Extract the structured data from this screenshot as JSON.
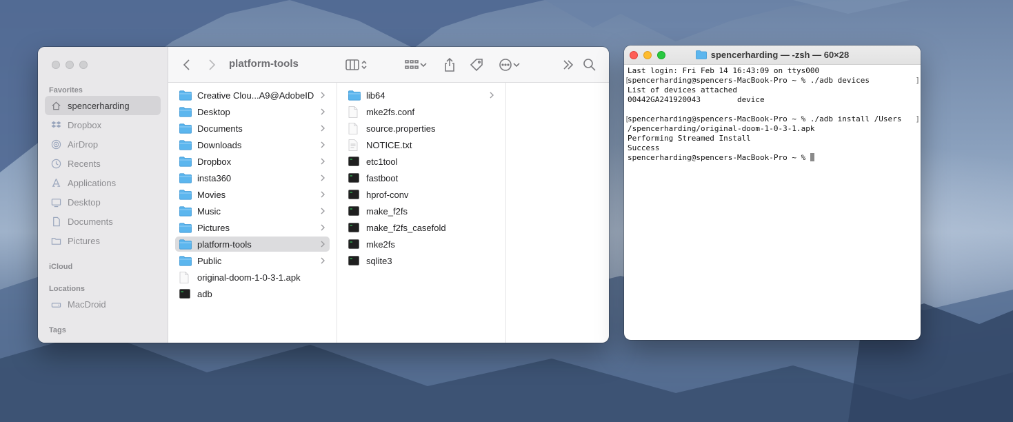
{
  "finder": {
    "title": "platform-tools",
    "sidebar": {
      "sections": {
        "favorites": "Favorites",
        "icloud": "iCloud",
        "locations": "Locations",
        "tags": "Tags"
      },
      "favorites": [
        {
          "label": "spencerharding",
          "icon": "home-icon",
          "active": true
        },
        {
          "label": "Dropbox",
          "icon": "dropbox-icon"
        },
        {
          "label": "AirDrop",
          "icon": "airdrop-icon"
        },
        {
          "label": "Recents",
          "icon": "clock-icon"
        },
        {
          "label": "Applications",
          "icon": "applications-icon"
        },
        {
          "label": "Desktop",
          "icon": "desktop-icon"
        },
        {
          "label": "Documents",
          "icon": "document-icon"
        },
        {
          "label": "Pictures",
          "icon": "folder-icon"
        }
      ],
      "locations": [
        {
          "label": "MacDroid",
          "icon": "drive-icon"
        }
      ]
    },
    "column1": [
      {
        "label": "Creative Clou...A9@AdobeID",
        "type": "folder",
        "chevron": true
      },
      {
        "label": "Desktop",
        "type": "folder",
        "chevron": true
      },
      {
        "label": "Documents",
        "type": "folder",
        "chevron": true
      },
      {
        "label": "Downloads",
        "type": "folder",
        "chevron": true
      },
      {
        "label": "Dropbox",
        "type": "folder",
        "chevron": true
      },
      {
        "label": "insta360",
        "type": "folder",
        "chevron": true
      },
      {
        "label": "Movies",
        "type": "folder",
        "chevron": true
      },
      {
        "label": "Music",
        "type": "folder",
        "chevron": true
      },
      {
        "label": "Pictures",
        "type": "folder",
        "chevron": true
      },
      {
        "label": "platform-tools",
        "type": "folder",
        "chevron": true,
        "selected": true
      },
      {
        "label": "Public",
        "type": "folder",
        "chevron": true
      },
      {
        "label": "original-doom-1-0-3-1.apk",
        "type": "file",
        "chevron": false
      },
      {
        "label": "adb",
        "type": "exec",
        "chevron": false
      }
    ],
    "column2": [
      {
        "label": "lib64",
        "type": "folder",
        "chevron": true
      },
      {
        "label": "mke2fs.conf",
        "type": "file",
        "chevron": false
      },
      {
        "label": "source.properties",
        "type": "file",
        "chevron": false
      },
      {
        "label": "NOTICE.txt",
        "type": "text",
        "chevron": false
      },
      {
        "label": "etc1tool",
        "type": "exec",
        "chevron": false
      },
      {
        "label": "fastboot",
        "type": "exec",
        "chevron": false
      },
      {
        "label": "hprof-conv",
        "type": "exec",
        "chevron": false
      },
      {
        "label": "make_f2fs",
        "type": "exec",
        "chevron": false
      },
      {
        "label": "make_f2fs_casefold",
        "type": "exec",
        "chevron": false
      },
      {
        "label": "mke2fs",
        "type": "exec",
        "chevron": false
      },
      {
        "label": "sqlite3",
        "type": "exec",
        "chevron": false
      }
    ]
  },
  "terminal": {
    "title": "spencerharding — -zsh — 60×28",
    "lines": [
      {
        "text": "Last login: Fri Feb 14 16:43:09 on ttys000",
        "mark": false
      },
      {
        "text": "spencerharding@spencers-MacBook-Pro ~ % ./adb devices",
        "mark": true
      },
      {
        "text": "List of devices attached",
        "mark": false
      },
      {
        "text": "00442GA241920043        device",
        "mark": false
      },
      {
        "text": "",
        "mark": false
      },
      {
        "text": "spencerharding@spencers-MacBook-Pro ~ % ./adb install /Users",
        "mark": true
      },
      {
        "text": "/spencerharding/original-doom-1-0-3-1.apk",
        "mark": false
      },
      {
        "text": "Performing Streamed Install",
        "mark": false
      },
      {
        "text": "Success",
        "mark": false
      },
      {
        "text": "spencerharding@spencers-MacBook-Pro ~ % ",
        "mark": false,
        "cursor": true
      }
    ]
  }
}
